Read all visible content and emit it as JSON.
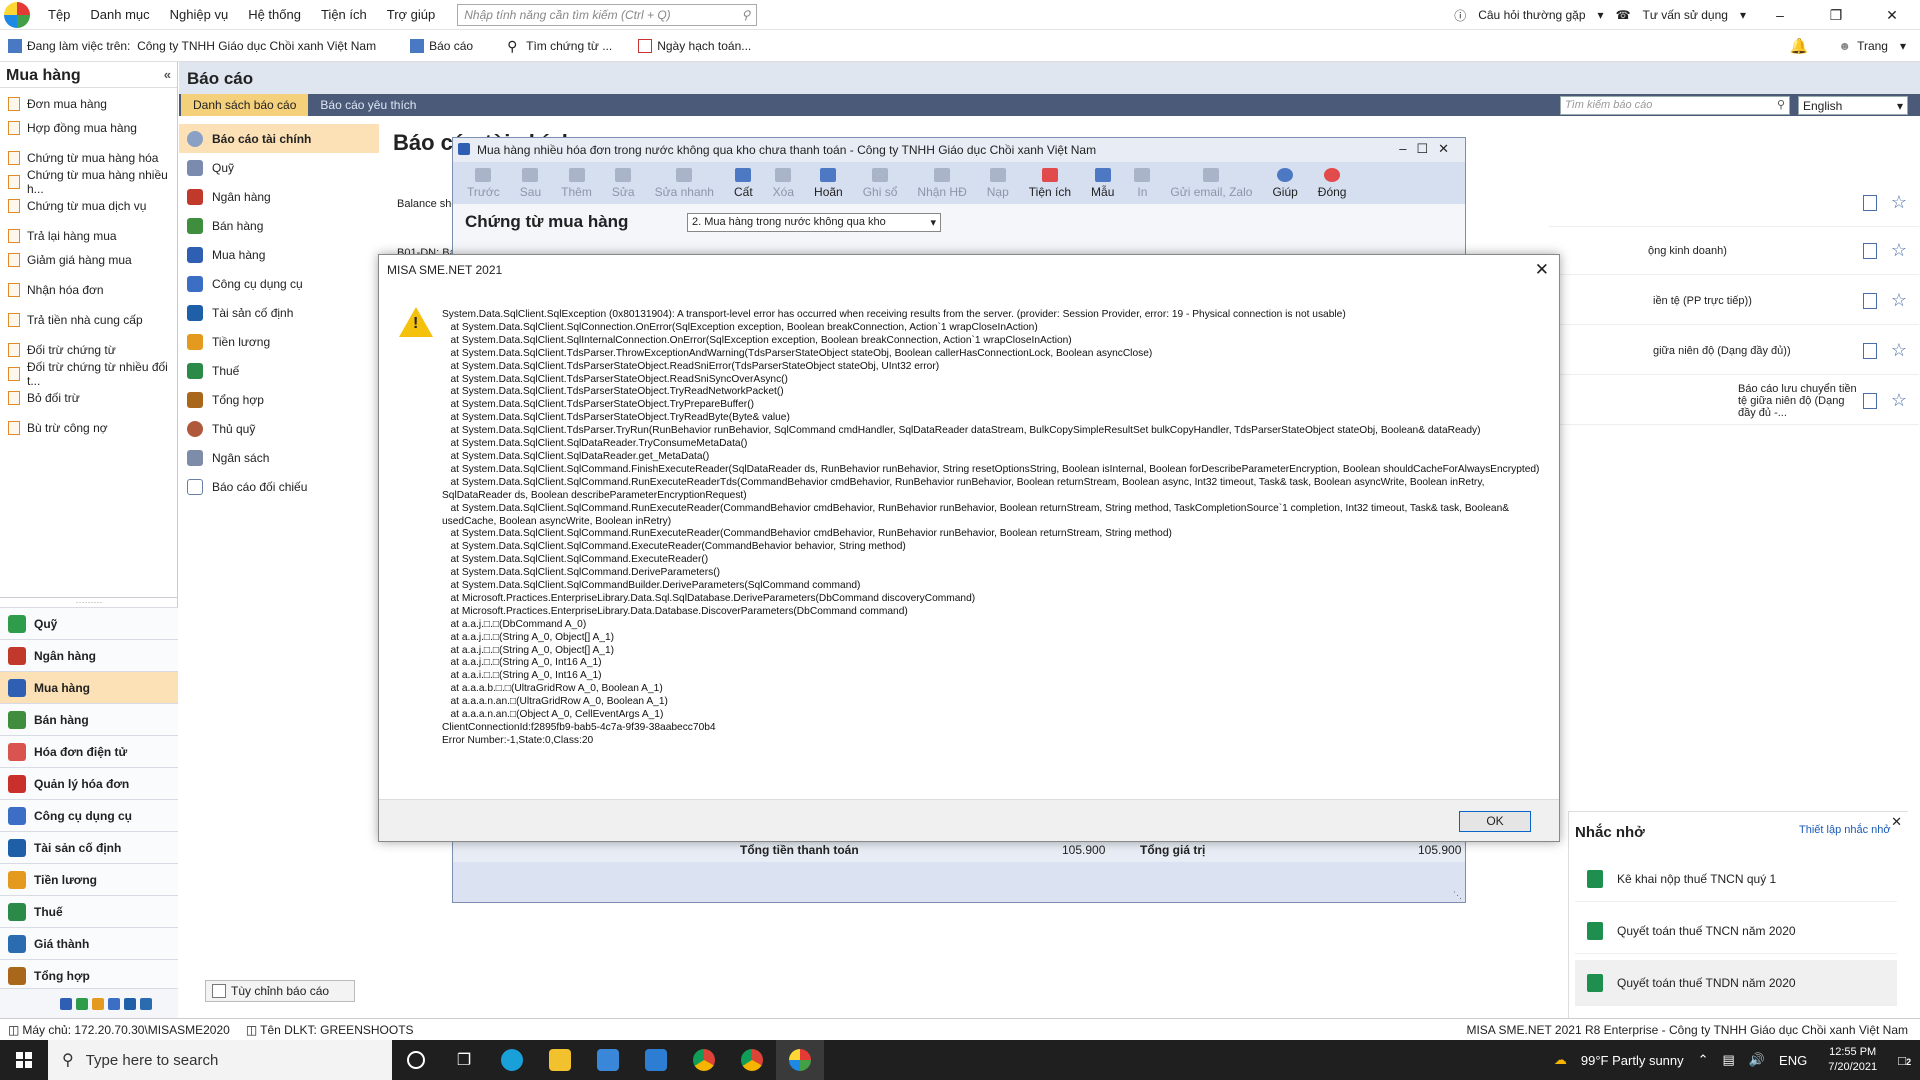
{
  "menubar": {
    "items": [
      "Tệp",
      "Danh mục",
      "Nghiệp vụ",
      "Hệ thống",
      "Tiện ích",
      "Trợ giúp"
    ],
    "search_placeholder": "Nhập tính năng cần tìm kiếm (Ctrl + Q)",
    "faq": "Câu hỏi thường gặp",
    "consult": "Tư vấn sử dụng"
  },
  "context": {
    "working_on": "Đang làm việc trên:",
    "company": "Công ty TNHH Giáo dục Chồi xanh Việt Nam",
    "report": "Báo cáo",
    "find_doc": "Tìm chứng từ ...",
    "posting_date": "Ngày hạch toán...",
    "user": "Trang"
  },
  "sidebar": {
    "title": "Mua hàng",
    "items": [
      "Đơn mua hàng",
      "Hợp đồng mua hàng",
      "Chứng từ mua hàng hóa",
      "Chứng từ mua hàng nhiều h...",
      "Chứng từ mua dịch vụ",
      "Trả lại hàng mua",
      "Giảm giá hàng mua",
      "Nhận hóa đơn",
      "Trả tiền nhà cung cấp",
      "Đối trừ chứng từ",
      "Đối trừ chứng từ nhiều đối t...",
      "Bỏ đối trừ",
      "Bù trừ công nợ"
    ],
    "modules": [
      "Quỹ",
      "Ngân hàng",
      "Mua hàng",
      "Bán hàng",
      "Hóa đơn điện tử",
      "Quản lý hóa đơn",
      "Công cụ dụng cụ",
      "Tài sản cố định",
      "Tiền lương",
      "Thuế",
      "Giá thành",
      "Tổng hợp"
    ]
  },
  "report": {
    "title": "Báo cáo",
    "tabs": [
      "Danh sách báo cáo",
      "Báo cáo yêu thích"
    ],
    "search_placeholder": "Tìm kiếm báo cáo",
    "language": "English",
    "categories": [
      "Báo cáo tài chính",
      "Quỹ",
      "Ngân hàng",
      "Bán hàng",
      "Mua hàng",
      "Công cụ dụng cụ",
      "Tài sản cố định",
      "Tiền lương",
      "Thuế",
      "Tổng hợp",
      "Thủ quỹ",
      "Ngân sách",
      "Báo cáo đối chiếu"
    ],
    "heading": "Báo cáo tài chính",
    "balance": "Balance she",
    "b01": "B01-DN: Ba",
    "rows": [
      "",
      "ộng kinh doanh)",
      "iền tệ (PP trực tiếp))",
      "giữa niên độ (Dạng đầy đủ))",
      "Báo cáo lưu chuyển tiền tệ giữa niên độ (Dạng đầy đủ -..."
    ],
    "customize": "Tùy chỉnh báo cáo"
  },
  "reminder": {
    "title": "Nhắc nhở",
    "setup": "Thiết lập nhắc nhở",
    "items": [
      "Kê khai nộp thuế TNCN quý 1",
      "Quyết toán thuế TNCN năm 2020",
      "Quyết toán thuế TNDN năm 2020"
    ]
  },
  "purchase_window": {
    "title": "Mua hàng nhiều hóa đơn trong nước không qua kho chưa thanh toán - Công ty TNHH Giáo dục Chồi xanh Việt Nam",
    "toolbar": [
      "Trước",
      "Sau",
      "Thêm",
      "Sửa",
      "Sửa nhanh",
      "Cất",
      "Xóa",
      "Hoãn",
      "Ghi sổ",
      "Nhận HĐ",
      "Nạp",
      "Tiện ích",
      "Mẫu",
      "In",
      "Gửi email, Zalo",
      "Giúp",
      "Đóng"
    ],
    "heading": "Chứng từ mua hàng",
    "type_select": "2. Mua hàng trong nước không qua kho",
    "total_payment_label": "Tổng tiền thanh toán",
    "total_payment": "105.900",
    "total_value_label": "Tổng giá trị",
    "total_value": "105.900"
  },
  "dialog": {
    "title": "MISA SME.NET 2021",
    "ok": "OK",
    "lines": [
      "System.Data.SqlClient.SqlException (0x80131904): A transport-level error has occurred when receiving results from the server. (provider: Session Provider, error: 19 - Physical connection is not usable)",
      "   at System.Data.SqlClient.SqlConnection.OnError(SqlException exception, Boolean breakConnection, Action`1 wrapCloseInAction)",
      "   at System.Data.SqlClient.SqlInternalConnection.OnError(SqlException exception, Boolean breakConnection, Action`1 wrapCloseInAction)",
      "   at System.Data.SqlClient.TdsParser.ThrowExceptionAndWarning(TdsParserStateObject stateObj, Boolean callerHasConnectionLock, Boolean asyncClose)",
      "   at System.Data.SqlClient.TdsParserStateObject.ReadSniError(TdsParserStateObject stateObj, UInt32 error)",
      "   at System.Data.SqlClient.TdsParserStateObject.ReadSniSyncOverAsync()",
      "   at System.Data.SqlClient.TdsParserStateObject.TryReadNetworkPacket()",
      "   at System.Data.SqlClient.TdsParserStateObject.TryPrepareBuffer()",
      "   at System.Data.SqlClient.TdsParserStateObject.TryReadByte(Byte& value)",
      "   at System.Data.SqlClient.TdsParser.TryRun(RunBehavior runBehavior, SqlCommand cmdHandler, SqlDataReader dataStream, BulkCopySimpleResultSet bulkCopyHandler, TdsParserStateObject stateObj, Boolean& dataReady)",
      "   at System.Data.SqlClient.SqlDataReader.TryConsumeMetaData()",
      "   at System.Data.SqlClient.SqlDataReader.get_MetaData()",
      "   at System.Data.SqlClient.SqlCommand.FinishExecuteReader(SqlDataReader ds, RunBehavior runBehavior, String resetOptionsString, Boolean isInternal, Boolean forDescribeParameterEncryption, Boolean shouldCacheForAlwaysEncrypted)",
      "   at System.Data.SqlClient.SqlCommand.RunExecuteReaderTds(CommandBehavior cmdBehavior, RunBehavior runBehavior, Boolean returnStream, Boolean async, Int32 timeout, Task& task, Boolean asyncWrite, Boolean inRetry, SqlDataReader ds, Boolean describeParameterEncryptionRequest)",
      "   at System.Data.SqlClient.SqlCommand.RunExecuteReader(CommandBehavior cmdBehavior, RunBehavior runBehavior, Boolean returnStream, String method, TaskCompletionSource`1 completion, Int32 timeout, Task& task, Boolean& usedCache, Boolean asyncWrite, Boolean inRetry)",
      "   at System.Data.SqlClient.SqlCommand.RunExecuteReader(CommandBehavior cmdBehavior, RunBehavior runBehavior, Boolean returnStream, String method)",
      "   at System.Data.SqlClient.SqlCommand.ExecuteReader(CommandBehavior behavior, String method)",
      "   at System.Data.SqlClient.SqlCommand.ExecuteReader()",
      "   at System.Data.SqlClient.SqlCommand.DeriveParameters()",
      "   at System.Data.SqlClient.SqlCommandBuilder.DeriveParameters(SqlCommand command)",
      "   at Microsoft.Practices.EnterpriseLibrary.Data.Sql.SqlDatabase.DeriveParameters(DbCommand discoveryCommand)",
      "   at Microsoft.Practices.EnterpriseLibrary.Data.Database.DiscoverParameters(DbCommand command)",
      "   at a.a.j.□.□(DbCommand A_0)",
      "   at a.a.j.□.□(String A_0, Object[] A_1)",
      "   at a.a.j.□.□(String A_0, Object[] A_1)",
      "   at a.a.j.□.□(String A_0, Int16 A_1)",
      "   at a.a.i.□.□(String A_0, Int16 A_1)",
      "   at a.a.a.b.□.□(UltraGridRow A_0, Boolean A_1)",
      "   at a.a.a.n.an.□(UltraGridRow A_0, Boolean A_1)",
      "   at a.a.a.n.an.□(Object A_0, CellEventArgs A_1)",
      "ClientConnectionId:f2895fb9-bab5-4c7a-9f39-38aabecc70b4",
      "Error Number:-1,State:0,Class:20"
    ]
  },
  "status": {
    "server": "Máy chủ: 172.20.70.30\\MISASME2020",
    "dlkt": "Tên DLKT: GREENSHOOTS",
    "product": "MISA SME.NET 2021 R8 Enterprise - Công ty TNHH Giáo dục Chồi xanh Việt Nam"
  },
  "taskbar": {
    "search_placeholder": "Type here to search",
    "weather": "99°F  Partly sunny",
    "lang": "ENG",
    "time": "12:55 PM",
    "date": "7/20/2021",
    "notifications": "2"
  },
  "colors": {
    "accent": "#f5d07a",
    "tab_bar": "#4a5a78",
    "warning": "#f4c20d",
    "taskbar": "#1f1f1f"
  }
}
